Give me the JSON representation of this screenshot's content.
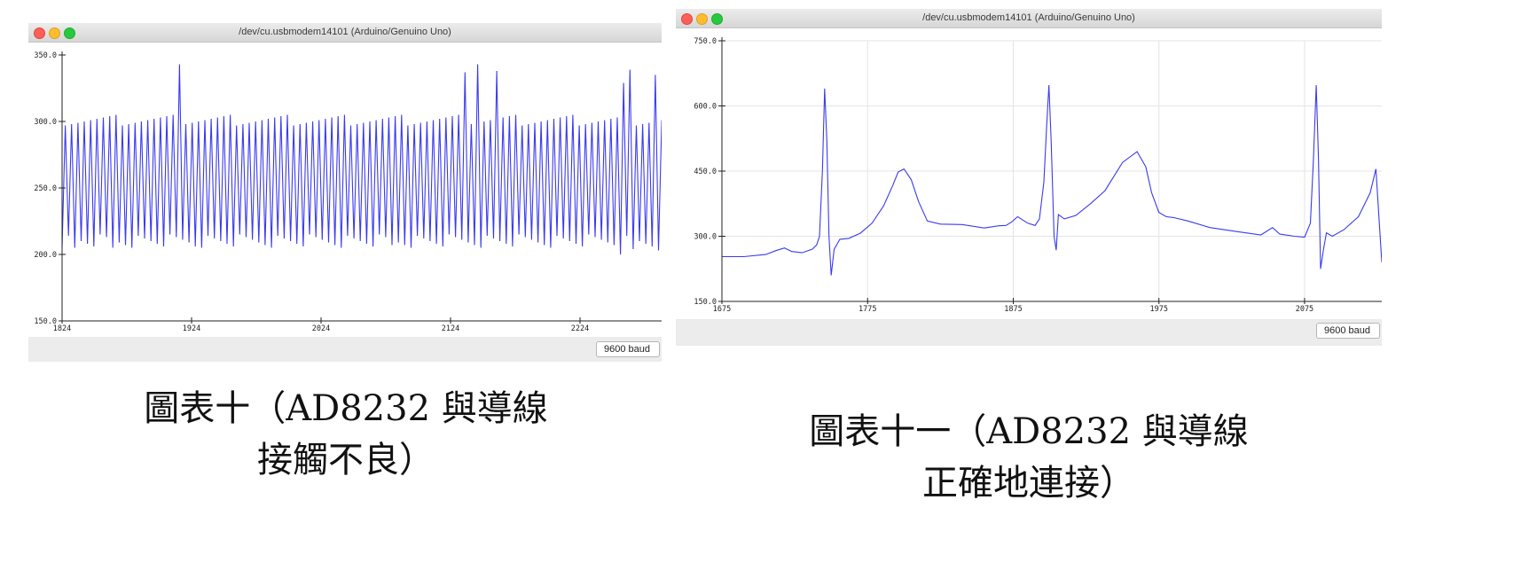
{
  "left_window": {
    "title": "/dev/cu.usbmodem14101 (Arduino/Genuino Uno)",
    "baud_label": "9600 baud",
    "caption_line1": "圖表十（AD8232 與導線",
    "caption_line2": "接觸不良）"
  },
  "right_window": {
    "title": "/dev/cu.usbmodem14101 (Arduino/Genuino Uno)",
    "baud_label": "9600 baud",
    "caption_line1": "圖表十一（AD8232 與導線",
    "caption_line2": "正確地連接）"
  },
  "colors": {
    "series": "#3a3af0",
    "axis": "#222222"
  },
  "chart_data": [
    {
      "type": "line",
      "title": "",
      "xlabel": "",
      "ylabel": "",
      "xlim": [
        1824,
        2287
      ],
      "ylim": [
        150,
        350
      ],
      "x_ticks": [
        "1824",
        "1924",
        "2024",
        "2124",
        "2224"
      ],
      "y_ticks": [
        "150.0",
        "200.0",
        "250.0",
        "300.0",
        "350.0"
      ],
      "grid": false,
      "series": [
        {
          "period": 4.9,
          "default_high": 301,
          "default_low": 210,
          "spikes": [
            {
              "x": 1913,
              "y": 343
            },
            {
              "x": 2137,
              "y": 337
            },
            {
              "x": 2145,
              "y": 343
            },
            {
              "x": 2162,
              "y": 338
            },
            {
              "x": 2257,
              "y": 329
            },
            {
              "x": 2264,
              "y": 339
            },
            {
              "x": 2284,
              "y": 335
            }
          ],
          "dips": [
            {
              "x": 1833,
              "y": 205
            },
            {
              "x": 1865,
              "y": 205
            },
            {
              "x": 1928,
              "y": 206
            },
            {
              "x": 2080,
              "y": 207
            },
            {
              "x": 2256,
              "y": 200
            },
            {
              "x": 2266,
              "y": 204
            },
            {
              "x": 2284,
              "y": 203
            }
          ]
        }
      ]
    },
    {
      "type": "line",
      "title": "",
      "xlabel": "",
      "ylabel": "",
      "xlim": [
        1675,
        2128
      ],
      "ylim": [
        150,
        750
      ],
      "x_ticks": [
        "1675",
        "1775",
        "1875",
        "1975",
        "2075"
      ],
      "y_ticks": [
        "150.0",
        "300.0",
        "450.0",
        "600.0",
        "750.0"
      ],
      "grid": true,
      "series": [
        {
          "x": [
            1675,
            1690,
            1705,
            1712,
            1718,
            1723,
            1730,
            1737,
            1740,
            1742,
            1744,
            1745.5,
            1747,
            1748.5,
            1750,
            1752,
            1756,
            1762,
            1770,
            1778,
            1786,
            1792,
            1796,
            1800,
            1805,
            1810,
            1816,
            1825,
            1840,
            1855,
            1865,
            1870,
            1874,
            1878,
            1885,
            1890,
            1893,
            1896,
            1898,
            1899.5,
            1901,
            1903,
            1904.5,
            1906,
            1910,
            1918,
            1928,
            1938,
            1950,
            1960,
            1966,
            1970,
            1975,
            1980,
            1985,
            1995,
            2010,
            2030,
            2045,
            2053,
            2058,
            2068,
            2075,
            2079,
            2081,
            2083,
            2084.5,
            2086,
            2088,
            2090,
            2094,
            2102,
            2112,
            2120,
            2124,
            2128
          ],
          "y": [
            253,
            253,
            258,
            267,
            273,
            265,
            262,
            270,
            280,
            300,
            450,
            640,
            520,
            300,
            210,
            270,
            293,
            295,
            307,
            330,
            370,
            415,
            448,
            455,
            430,
            380,
            335,
            328,
            327,
            319,
            324,
            325,
            333,
            345,
            330,
            325,
            340,
            425,
            560,
            648,
            520,
            300,
            268,
            350,
            340,
            348,
            375,
            405,
            470,
            495,
            460,
            400,
            355,
            345,
            343,
            335,
            320,
            310,
            303,
            320,
            305,
            300,
            298,
            330,
            470,
            648,
            480,
            225,
            270,
            308,
            300,
            315,
            345,
            400,
            455,
            240
          ]
        }
      ]
    }
  ]
}
